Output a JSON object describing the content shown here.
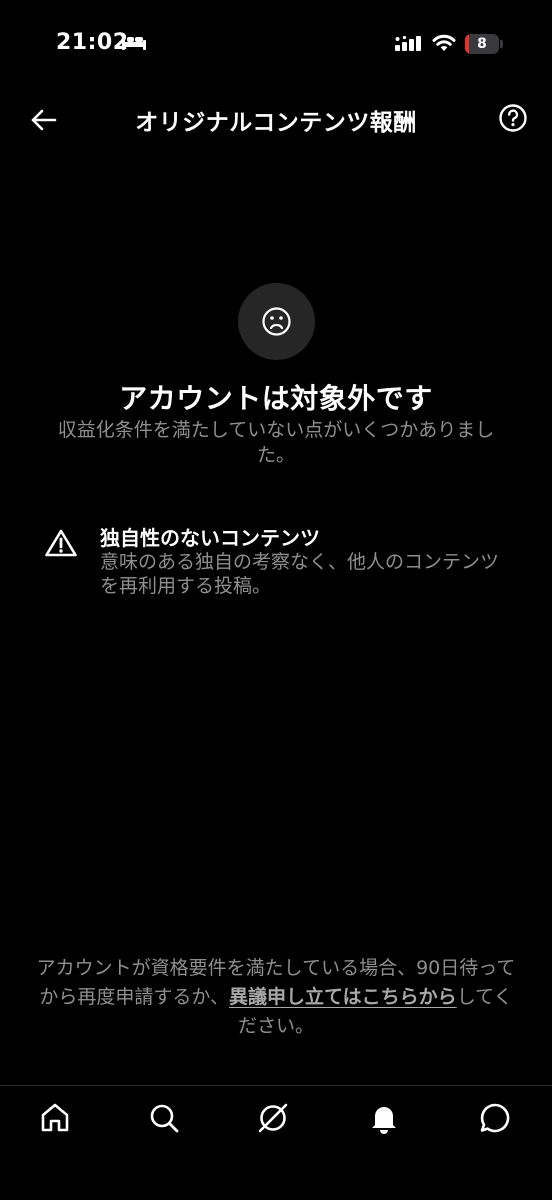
{
  "status_bar": {
    "time": "21:02",
    "battery_level": "8",
    "battery_fraction": 0.08
  },
  "header": {
    "title": "オリジナルコンテンツ報酬"
  },
  "main": {
    "title": "アカウントは対象外です",
    "subtitle": "収益化条件を満たしていない点がいくつかありました。",
    "reason": {
      "title": "独自性のないコンテンツ",
      "description": "意味のある独自の考察なく、他人のコンテンツを再利用する投稿。"
    }
  },
  "footer": {
    "note_before": "アカウントが資格要件を満たしている場合、90日待ってから再度申請するか、",
    "appeal_link": "異議申し立てはこちら",
    "note_middle": "から",
    "note_after": "してください。"
  },
  "icons": {
    "back": "arrow-left-icon",
    "help": "question-circle-icon",
    "sad": "sad-face-icon",
    "warning": "warning-triangle-icon",
    "nav": [
      "home-icon",
      "search-icon",
      "explore-icon",
      "notifications-icon",
      "messages-icon"
    ]
  },
  "colors": {
    "background": "#000000",
    "text_primary": "#ffffff",
    "text_secondary": "#8e8e8e",
    "battery_low": "#e5322e"
  }
}
